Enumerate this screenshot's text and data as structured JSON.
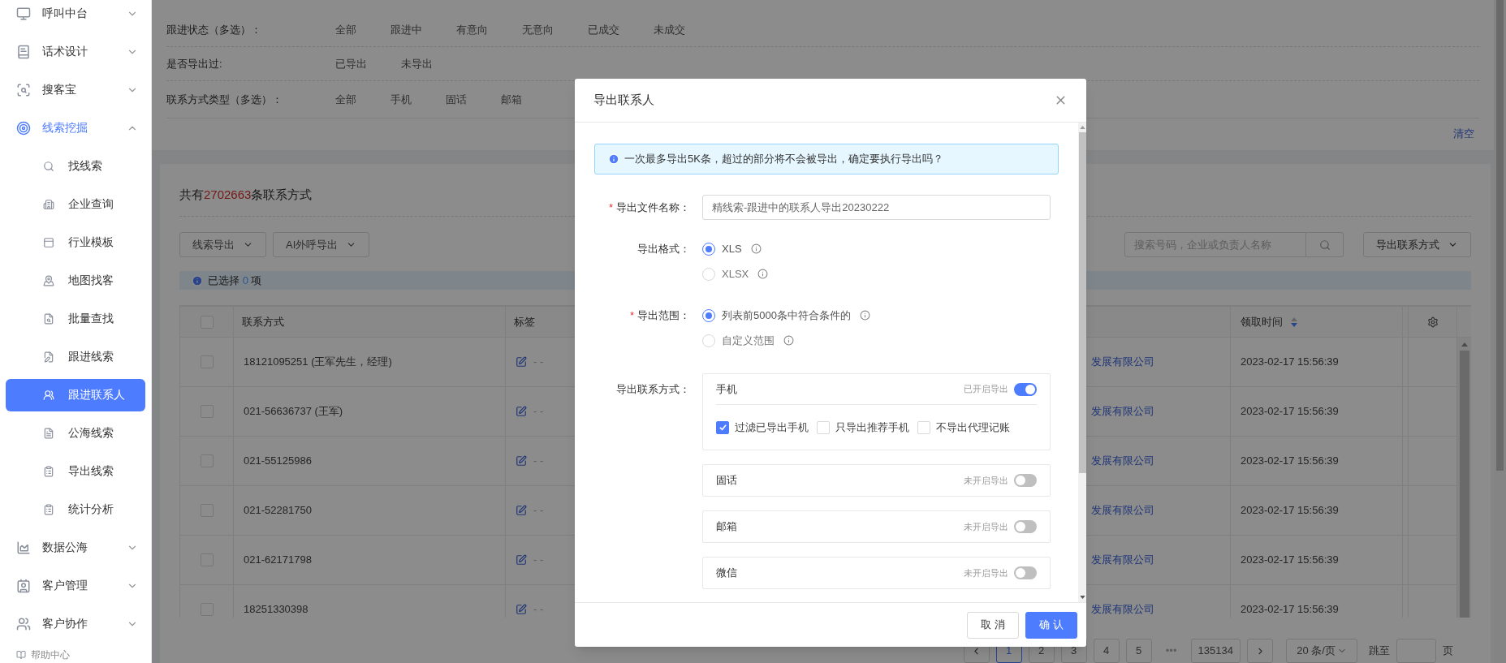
{
  "sidebar": {
    "items": [
      {
        "label": "呼叫中台",
        "expanded": false
      },
      {
        "label": "话术设计",
        "expanded": false
      },
      {
        "label": "搜客宝",
        "expanded": false
      },
      {
        "label": "线索挖掘",
        "expanded": true,
        "children": [
          {
            "label": "找线索",
            "selected": false
          },
          {
            "label": "企业查询",
            "selected": false
          },
          {
            "label": "行业模板",
            "selected": false
          },
          {
            "label": "地图找客",
            "selected": false
          },
          {
            "label": "批量查找",
            "selected": false
          },
          {
            "label": "跟进线索",
            "selected": false
          },
          {
            "label": "跟进联系人",
            "selected": true
          },
          {
            "label": "公海线索",
            "selected": false
          },
          {
            "label": "导出线索",
            "selected": false
          },
          {
            "label": "统计分析",
            "selected": false
          }
        ]
      },
      {
        "label": "数据公海",
        "expanded": false
      },
      {
        "label": "客户管理",
        "expanded": false
      },
      {
        "label": "客户协作",
        "expanded": false
      }
    ],
    "help": "帮助中心"
  },
  "filters": {
    "rows": [
      {
        "label": "跟进状态（多选）：",
        "options": [
          "全部",
          "跟进中",
          "有意向",
          "无意向",
          "已成交",
          "未成交"
        ]
      },
      {
        "label": "是否导出过:",
        "options": [
          "已导出",
          "未导出"
        ]
      },
      {
        "label": "联系方式类型（多选）：",
        "options": [
          "全部",
          "手机",
          "固话",
          "邮箱"
        ]
      }
    ],
    "clear": "清空"
  },
  "summary": {
    "prefix": "共有",
    "count": "2702663",
    "suffix": "条联系方式"
  },
  "toolbar": {
    "buttons": [
      "线索导出",
      "AI外呼导出"
    ],
    "search_placeholder": "搜索号码，企业或负责人名称",
    "export_button": "导出联系方式"
  },
  "selection": {
    "prefix": "已选择",
    "count": "0",
    "suffix": "项"
  },
  "table": {
    "select_all_checked": false,
    "columns": [
      "联系方式",
      "标签",
      "领取时间"
    ],
    "rows": [
      {
        "checked": false,
        "contact": "18121095251 (王军先生，经理)",
        "tag": "- -",
        "company": "发展有限公司",
        "time": "2023-02-17 15:56:39"
      },
      {
        "checked": false,
        "contact": "021-56636737 (王军)",
        "tag": "- -",
        "company": "发展有限公司",
        "time": "2023-02-17 15:56:39"
      },
      {
        "checked": false,
        "contact": "021-55125986",
        "tag": "- -",
        "company": "发展有限公司",
        "time": "2023-02-17 15:56:39"
      },
      {
        "checked": false,
        "contact": "021-52281750",
        "tag": "- -",
        "company": "发展有限公司",
        "time": "2023-02-17 15:56:39"
      },
      {
        "checked": false,
        "contact": "021-62171798",
        "tag": "- -",
        "company": "发展有限公司",
        "time": "2023-02-17 15:56:39"
      },
      {
        "checked": false,
        "contact": "18251330398",
        "tag": "- -",
        "company": "发展有限公司",
        "time": "2023-02-17 15:56:39"
      }
    ]
  },
  "pagination": {
    "pages": [
      {
        "label": "1",
        "selected": true
      },
      {
        "label": "2",
        "selected": false
      },
      {
        "label": "3",
        "selected": false
      },
      {
        "label": "4",
        "selected": false
      },
      {
        "label": "5",
        "selected": false
      }
    ],
    "ellipsis": "•••",
    "last": "135134",
    "page_size": "20 条/页",
    "jump_label": "跳至",
    "unit": "页"
  },
  "modal": {
    "title": "导出联系人",
    "alert": "一次最多导出5K条，超过的部分将不会被导出，确定要执行导出吗？",
    "file_name": {
      "label": "导出文件名称：",
      "required_mark": "*",
      "value": "精线索-跟进中的联系人导出20230222"
    },
    "format": {
      "label": "导出格式：",
      "options": [
        {
          "label": "XLS",
          "selected": true
        },
        {
          "label": "XLSX",
          "selected": false
        }
      ]
    },
    "range": {
      "label": "导出范围：",
      "required_mark": "*",
      "options": [
        {
          "label": "列表前5000条中符合条件的",
          "selected": true
        },
        {
          "label": "自定义范围",
          "selected": false
        }
      ]
    },
    "contact_types": {
      "label": "导出联系方式：",
      "items": [
        {
          "name": "手机",
          "status": "已开启导出",
          "on": true,
          "options": [
            {
              "label": "过滤已导出手机",
              "checked": true
            },
            {
              "label": "只导出推荐手机",
              "checked": false
            },
            {
              "label": "不导出代理记账",
              "checked": false
            }
          ]
        },
        {
          "name": "固话",
          "status": "未开启导出",
          "on": false
        },
        {
          "name": "邮箱",
          "status": "未开启导出",
          "on": false
        },
        {
          "name": "微信",
          "status": "未开启导出",
          "on": false
        }
      ]
    },
    "buttons": [
      {
        "label": "取 消",
        "kind": "default"
      },
      {
        "label": "确 认",
        "kind": "primary"
      }
    ]
  }
}
